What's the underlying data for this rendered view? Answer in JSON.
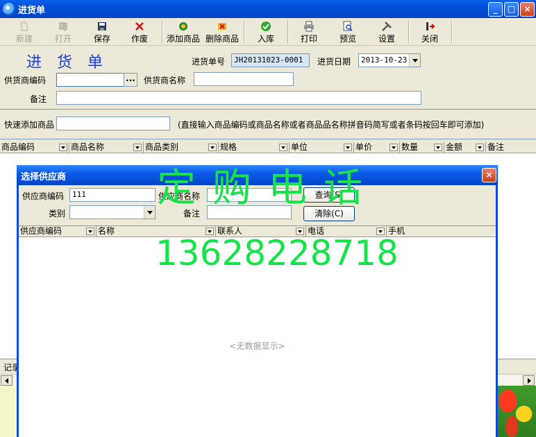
{
  "window": {
    "title": "进货单",
    "min": "_",
    "max": "□",
    "close": "×"
  },
  "toolbar": {
    "new": "新建",
    "open": "打开",
    "save": "保存",
    "void": "作废",
    "add_item": "添加商品",
    "delete_item": "删除商品",
    "stock_in": "入库",
    "print": "打印",
    "preview": "预览",
    "settings": "设置",
    "close": "关闭"
  },
  "form": {
    "doc_title": "进货单",
    "doc_no_label": "进货单号",
    "doc_no_value": "JH20131023-0001",
    "date_label": "进货日期",
    "date_value": "2013-10-23",
    "supplier_code_label": "供货商编码",
    "supplier_code_value": "",
    "ellipsis": "...",
    "supplier_name_label": "供货商名称",
    "supplier_name_value": "",
    "remark_label": "备注",
    "remark_value": ""
  },
  "quick_add": {
    "label": "快速添加商品",
    "value": "",
    "hint": "(直接输入商品编码或商品名称或者商品品名称拼音码简写或者条码按回车即可添加)"
  },
  "grid": {
    "columns": [
      "商品编码",
      "商品名称",
      "商品类别",
      "规格",
      "单位",
      "单价",
      "数量",
      "金额",
      "备注"
    ]
  },
  "record_bar": {
    "label": "记录"
  },
  "dialog": {
    "title": "选择供应商",
    "supplier_code_label": "供应商编码",
    "supplier_code_value": "111",
    "supplier_name_label": "供应商名称",
    "supplier_name_value": "",
    "category_label": "类别",
    "category_value": "",
    "remark_label": "备注",
    "remark_value": "",
    "query_button": "查询(S)",
    "clear_button": "清除(C)",
    "columns": [
      "供应商编码",
      "名称",
      "联系人",
      "电话",
      "手机"
    ],
    "empty_text": "<无数据显示>",
    "close": "×"
  },
  "watermark": {
    "line1": "定购电话",
    "line2": "13628228718"
  },
  "colors": {
    "titlebar": "#0250D8",
    "watermark": "#16E24A",
    "doc_title": "#1F3FD0"
  }
}
